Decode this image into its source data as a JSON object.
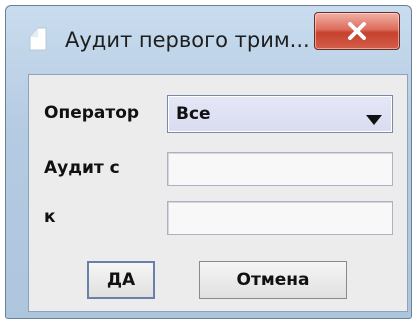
{
  "window": {
    "title": "Аудит первого трим...",
    "close_label": "x"
  },
  "form": {
    "operator_label": "Оператор",
    "operator_value": "Все",
    "audit_from_label": "Аудит с",
    "audit_from_value": "",
    "to_label": "к",
    "to_value": ""
  },
  "buttons": {
    "ok_label": "ДА",
    "cancel_label": "Отмена"
  },
  "icons": {
    "app": "document-icon",
    "close": "close-icon",
    "dropdown": "triangle-down-icon"
  },
  "colors": {
    "frame": "#b5cbe2",
    "close_button": "#c6412e",
    "client_background": "#ececec"
  }
}
